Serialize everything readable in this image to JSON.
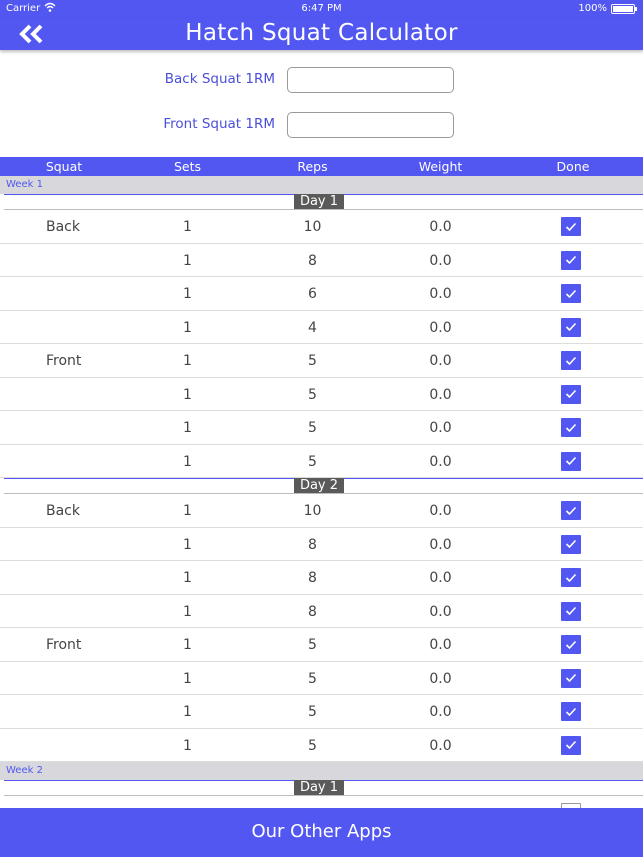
{
  "status": {
    "carrier": "Carrier",
    "time": "6:47 PM",
    "battery": "100%"
  },
  "nav": {
    "title": "Hatch Squat Calculator"
  },
  "inputs": {
    "back_label": "Back Squat 1RM",
    "back_value": "",
    "front_label": "Front Squat 1RM",
    "front_value": ""
  },
  "table": {
    "headers": [
      "Squat",
      "Sets",
      "Reps",
      "Weight",
      "Done"
    ]
  },
  "weeks": [
    {
      "label": "Week 1",
      "days": [
        {
          "label": "Day 1",
          "rows": [
            {
              "squat": "Back",
              "sets": "1",
              "reps": "10",
              "weight": "0.0",
              "done": true
            },
            {
              "squat": "",
              "sets": "1",
              "reps": "8",
              "weight": "0.0",
              "done": true
            },
            {
              "squat": "",
              "sets": "1",
              "reps": "6",
              "weight": "0.0",
              "done": true
            },
            {
              "squat": "",
              "sets": "1",
              "reps": "4",
              "weight": "0.0",
              "done": true
            },
            {
              "squat": "Front",
              "sets": "1",
              "reps": "5",
              "weight": "0.0",
              "done": true
            },
            {
              "squat": "",
              "sets": "1",
              "reps": "5",
              "weight": "0.0",
              "done": true
            },
            {
              "squat": "",
              "sets": "1",
              "reps": "5",
              "weight": "0.0",
              "done": true
            },
            {
              "squat": "",
              "sets": "1",
              "reps": "5",
              "weight": "0.0",
              "done": true
            }
          ]
        },
        {
          "label": "Day 2",
          "rows": [
            {
              "squat": "Back",
              "sets": "1",
              "reps": "10",
              "weight": "0.0",
              "done": true
            },
            {
              "squat": "",
              "sets": "1",
              "reps": "8",
              "weight": "0.0",
              "done": true
            },
            {
              "squat": "",
              "sets": "1",
              "reps": "8",
              "weight": "0.0",
              "done": true
            },
            {
              "squat": "",
              "sets": "1",
              "reps": "8",
              "weight": "0.0",
              "done": true
            },
            {
              "squat": "Front",
              "sets": "1",
              "reps": "5",
              "weight": "0.0",
              "done": true
            },
            {
              "squat": "",
              "sets": "1",
              "reps": "5",
              "weight": "0.0",
              "done": true
            },
            {
              "squat": "",
              "sets": "1",
              "reps": "5",
              "weight": "0.0",
              "done": true
            },
            {
              "squat": "",
              "sets": "1",
              "reps": "5",
              "weight": "0.0",
              "done": true
            }
          ]
        }
      ]
    },
    {
      "label": "Week 2",
      "days": [
        {
          "label": "Day 1",
          "rows": [
            {
              "squat": "",
              "sets": "",
              "reps": "",
              "weight": "",
              "done": false
            }
          ]
        }
      ]
    }
  ],
  "footer": {
    "label": "Our Other Apps"
  },
  "colors": {
    "accent": "#5157f0",
    "day_pill": "#5a5a5a",
    "week_band": "#d8d8dc"
  },
  "icons": {
    "back": "double-chevron-left-icon",
    "wifi": "wifi-icon",
    "battery": "battery-icon",
    "check": "checkmark-icon"
  }
}
